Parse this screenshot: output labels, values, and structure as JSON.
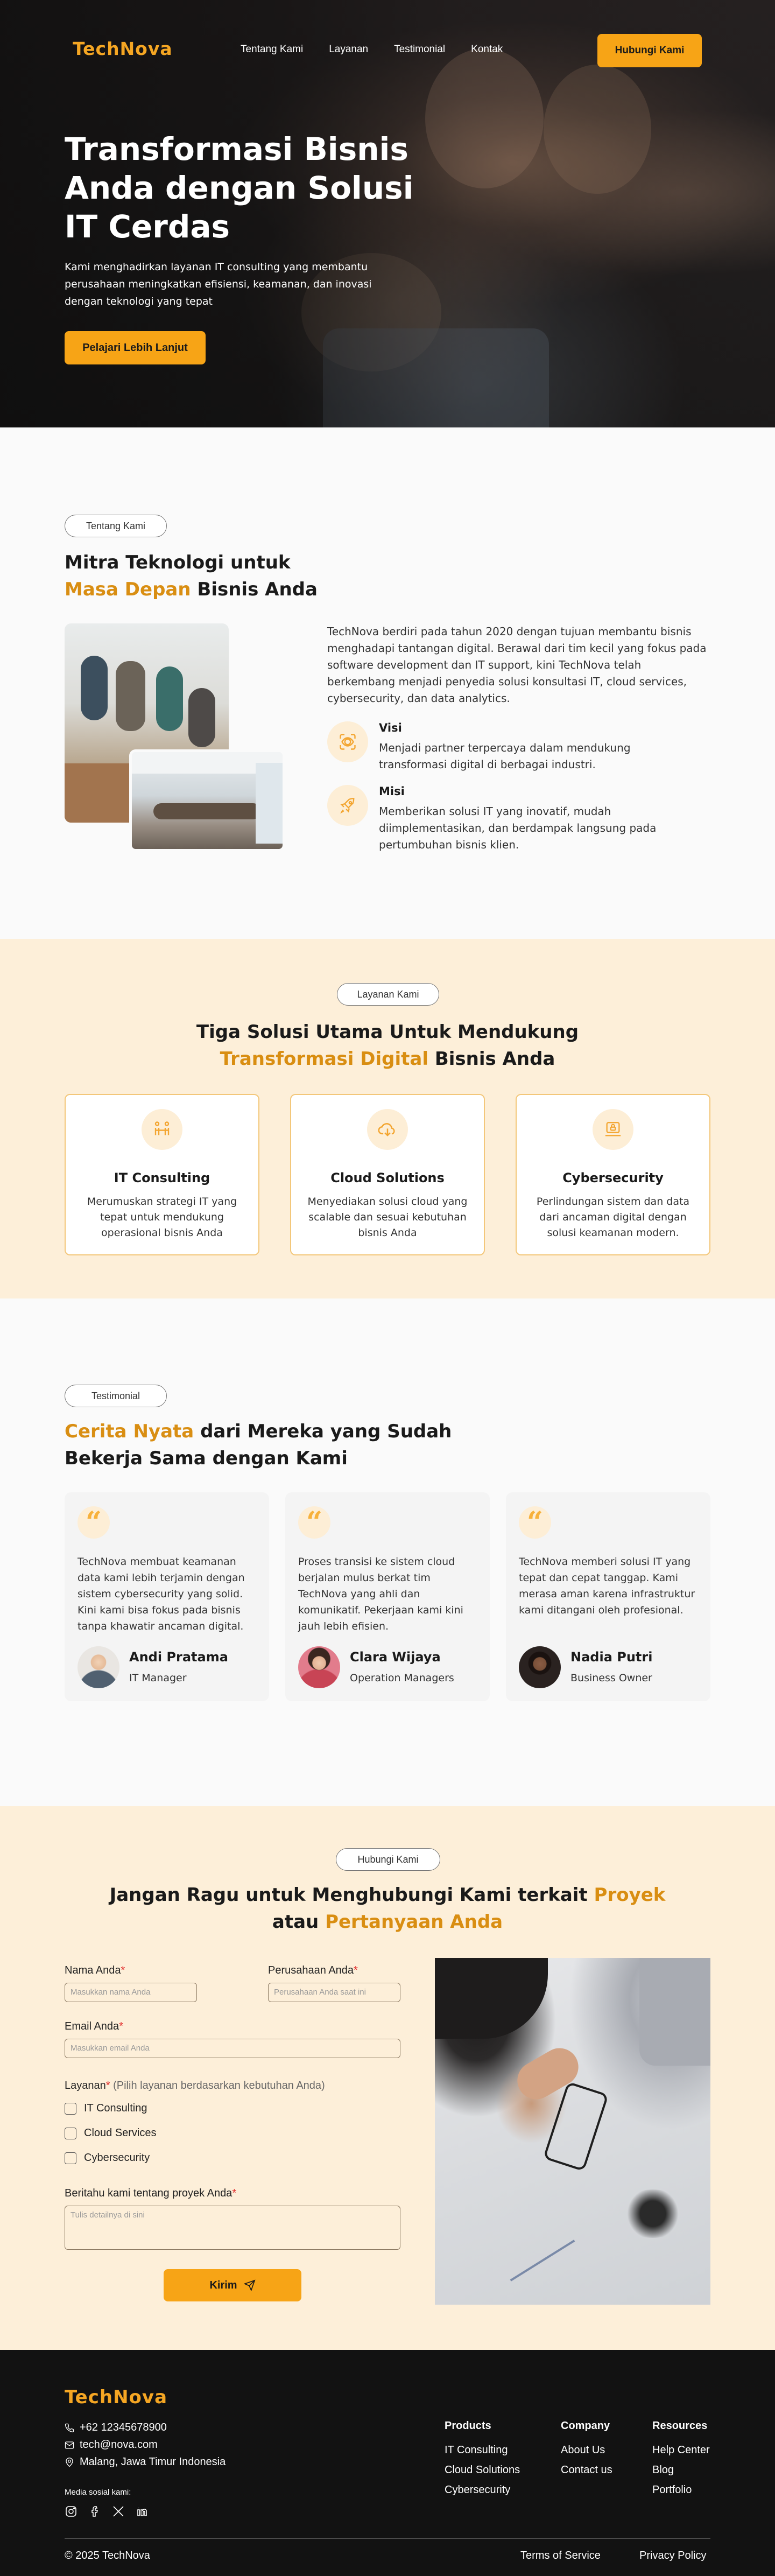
{
  "nav": {
    "logo": "TechNova",
    "links": [
      "Tentang Kami",
      "Layanan",
      "Testimonial",
      "Kontak"
    ],
    "cta": "Hubungi Kami"
  },
  "hero": {
    "title": "Transformasi Bisnis Anda dengan Solusi IT Cerdas",
    "subtitle": "Kami menghadirkan layanan IT consulting yang membantu perusahaan meningkatkan efisiensi, keamanan, dan inovasi dengan teknologi yang tepat",
    "cta": "Pelajari Lebih Lanjut"
  },
  "about": {
    "pill": "Tentang Kami",
    "title_a": "Mitra Teknologi untuk",
    "title_b_hl": "Masa Depan",
    "title_b_rest": " Bisnis Anda",
    "text": "TechNova berdiri pada tahun 2020 dengan tujuan membantu bisnis menghadapi tantangan digital. Berawal dari tim kecil yang fokus pada software development dan IT support, kini TechNova telah berkembang menjadi penyedia solusi konsultasi IT, cloud services, cybersecurity, dan data analytics.",
    "vision_title": "Visi",
    "vision_text": "Menjadi partner terpercaya dalam mendukung transformasi digital di berbagai industri.",
    "mission_title": "Misi",
    "mission_text": "Memberikan solusi IT yang inovatif, mudah diimplementasikan, dan berdampak langsung pada pertumbuhan bisnis klien."
  },
  "services": {
    "pill": "Layanan Kami",
    "title_a": "Tiga Solusi Utama Untuk Mendukung",
    "title_b_hl": "Transformasi Digital",
    "title_b_rest": " Bisnis Anda",
    "cards": [
      {
        "title": "IT Consulting",
        "text": "Merumuskan strategi IT yang tepat untuk mendukung operasional bisnis Anda"
      },
      {
        "title": "Cloud Solutions",
        "text": "Menyediakan solusi cloud yang scalable dan sesuai kebutuhan bisnis Anda"
      },
      {
        "title": "Cybersecurity",
        "text": "Perlindungan sistem dan data dari ancaman digital dengan solusi keamanan modern."
      }
    ]
  },
  "testimonials": {
    "pill": "Testimonial",
    "title_hl": "Cerita Nyata",
    "title_rest": " dari Mereka yang Sudah Bekerja Sama dengan Kami",
    "items": [
      {
        "text": "TechNova membuat keamanan data kami lebih terjamin dengan sistem cybersecurity yang solid. Kini kami bisa fokus pada bisnis tanpa khawatir ancaman digital.",
        "name": "Andi Pratama",
        "role": "IT Manager"
      },
      {
        "text": "Proses transisi ke sistem cloud berjalan mulus berkat tim TechNova yang ahli dan komunikatif. Pekerjaan kami kini jauh lebih efisien.",
        "name": "Clara Wijaya",
        "role": "Operation Managers"
      },
      {
        "text": "TechNova memberi solusi IT yang tepat dan cepat tanggap. Kami merasa aman karena infrastruktur kami ditangani oleh profesional.",
        "name": "Nadia Putri",
        "role": "Business Owner"
      }
    ]
  },
  "contact": {
    "pill": "Hubungi Kami",
    "title_a": "Jangan Ragu untuk Menghubungi Kami terkait ",
    "title_a_hl": "Proyek",
    "title_b": "atau ",
    "title_b_hl": "Pertanyaan Anda",
    "name_label": "Nama Anda",
    "name_ph": "Masukkan nama Anda",
    "company_label": "Perusahaan Anda",
    "company_ph": "Perusahaan Anda saat ini",
    "email_label": "Email Anda",
    "email_ph": "Masukkan email Anda",
    "service_label": "Layanan",
    "service_hint": "(Pilih layanan berdasarkan kebutuhan Anda)",
    "options": [
      "IT Consulting",
      "Cloud Services",
      "Cybersecurity"
    ],
    "message_label": "Beritahu kami tentang proyek Anda",
    "message_ph": "Tulis detailnya di sini",
    "required_mark": "*",
    "submit": "Kirim"
  },
  "footer": {
    "logo": "TechNova",
    "phone": "+62 12345678900",
    "email": "tech@nova.com",
    "address": "Malang, Jawa Timur Indonesia",
    "social_label": "Media sosial kami:",
    "cols": [
      {
        "title": "Products",
        "items": [
          "IT Consulting",
          "Cloud Solutions",
          "Cybersecurity"
        ]
      },
      {
        "title": "Company",
        "items": [
          "About Us",
          "Contact us"
        ]
      },
      {
        "title": "Resources",
        "items": [
          "Help Center",
          "Blog",
          "Portfolio"
        ]
      }
    ],
    "copyright": "© 2025 TechNova",
    "terms": "Terms of Service",
    "privacy": "Privacy Policy"
  },
  "colors": {
    "accent": "#f7a416",
    "accent_text": "#d98e12",
    "cream": "#fdefd9",
    "footer_bg": "#121212"
  }
}
